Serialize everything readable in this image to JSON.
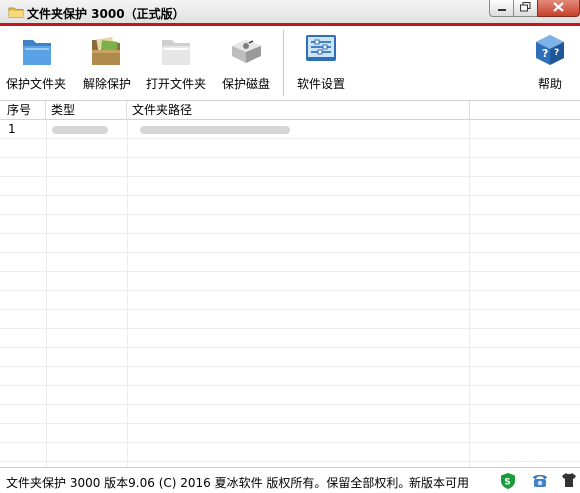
{
  "window": {
    "title": "文件夹保护 3000（正式版）"
  },
  "toolbar": {
    "protect_folder": "保护文件夹",
    "unprotect": "解除保护",
    "open_folder": "打开文件夹",
    "protect_disk": "保护磁盘",
    "settings": "软件设置",
    "help": "帮助"
  },
  "table": {
    "columns": [
      "序号",
      "类型",
      "文件夹路径"
    ],
    "rows": [
      {
        "index": "1"
      }
    ]
  },
  "status": {
    "copyright": "文件夹保护 3000 版本9.06 (C) 2016 夏冰软件 版权所有。保留全部权利。",
    "update": "新版本可用"
  },
  "colors": {
    "accent_red": "#c8141b",
    "icon_blue": "#3f82c8",
    "status_green": "#1a9b3c"
  }
}
